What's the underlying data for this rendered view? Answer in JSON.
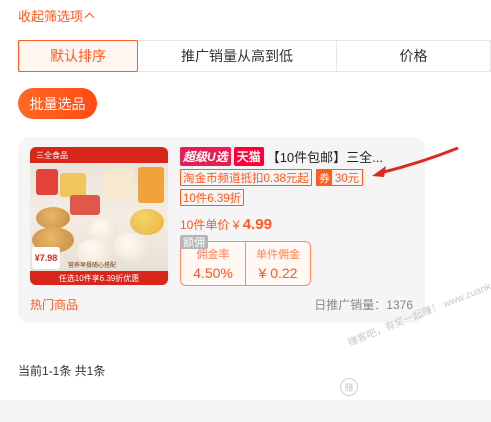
{
  "filter": {
    "collapse_label": "收起筛选项"
  },
  "sort": {
    "tabs": [
      {
        "label": "默认排序",
        "active": true
      },
      {
        "label": "推广销量从高到低",
        "active": false
      },
      {
        "label": "价格",
        "active": false
      }
    ]
  },
  "batch_select_label": "批量选品",
  "product": {
    "tag_u": "超级U选",
    "tag_tmall": "天猫",
    "title": "【10件包邮】三全...",
    "discount_label": "淘金币频道抵扣0.38元起",
    "coupon_prefix": "券",
    "coupon_value": "30元",
    "discount2_label": "10件6.39折",
    "unit_price_label": "10件单价",
    "unit_price_symbol": "¥",
    "unit_price": "4.99",
    "commission_tag": "额佣",
    "commission_rate_label": "佣金率",
    "commission_rate": "4.50%",
    "commission_unit_label": "单件佣金",
    "commission_unit": "¥ 0.22",
    "shop_type": "热门商品",
    "daily_sales_label": "日推广销量：",
    "daily_sales": "1376",
    "image": {
      "brand": "三全食品",
      "price_tag": "¥7.98",
      "sub_caption": "营养早餐随心搭配",
      "footer": "任选10件享6.39折优惠"
    }
  },
  "pagination": "当前1-1条 共1条",
  "watermark": {
    "text": "赚客吧，有奖一起赚！ www.zuanke8.com",
    "logo": "赚"
  },
  "colors": {
    "accent": "#ff5a1f",
    "tmall": "#ff0036",
    "u_select": "#e51f56",
    "arrow": "#e0281e"
  }
}
